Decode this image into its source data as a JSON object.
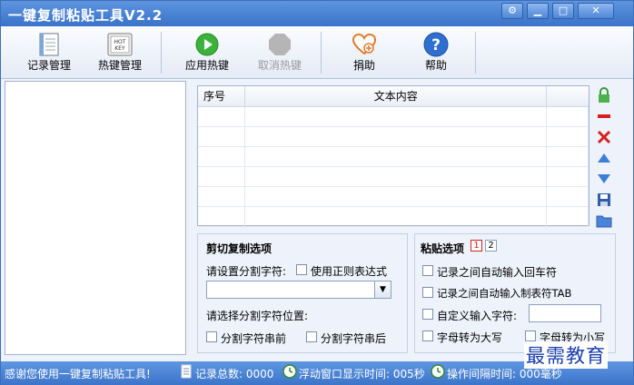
{
  "window": {
    "title": "一键复制粘贴工具V2.2"
  },
  "toolbar": {
    "items": [
      {
        "label": "记录管理",
        "icon": "notebook-icon"
      },
      {
        "label": "热键管理",
        "icon": "hotkey-icon"
      },
      {
        "label": "应用热键",
        "icon": "play-icon"
      },
      {
        "label": "取消热键",
        "icon": "stop-icon"
      },
      {
        "label": "捐助",
        "icon": "heart-icon"
      },
      {
        "label": "帮助",
        "icon": "help-icon"
      }
    ]
  },
  "grid": {
    "columns": [
      "序号",
      "文本内容"
    ]
  },
  "cut": {
    "title": "剪切复制选项",
    "sep_label": "请设置分割字符:",
    "regex_label": "使用正则表达式",
    "pos_label": "请选择分割字符位置:",
    "before_label": "分割字符串前",
    "after_label": "分割字符串后"
  },
  "paste": {
    "title": "粘贴选项",
    "tab1": "1",
    "tab2": "2",
    "opt_enter": "记录之间自动输入回车符",
    "opt_tab": "记录之间自动输入制表符TAB",
    "opt_custom": "自定义输入字符:",
    "opt_upper": "字母转为大写",
    "opt_lower": "字母转为小写"
  },
  "status": {
    "thanks": "感谢您使用一键复制粘贴工具!",
    "total": "记录总数: 0000",
    "float": "浮动窗口显示时间: 005秒",
    "interval": "操作间隔时间: 000毫秒"
  },
  "watermark": "最需教育"
}
